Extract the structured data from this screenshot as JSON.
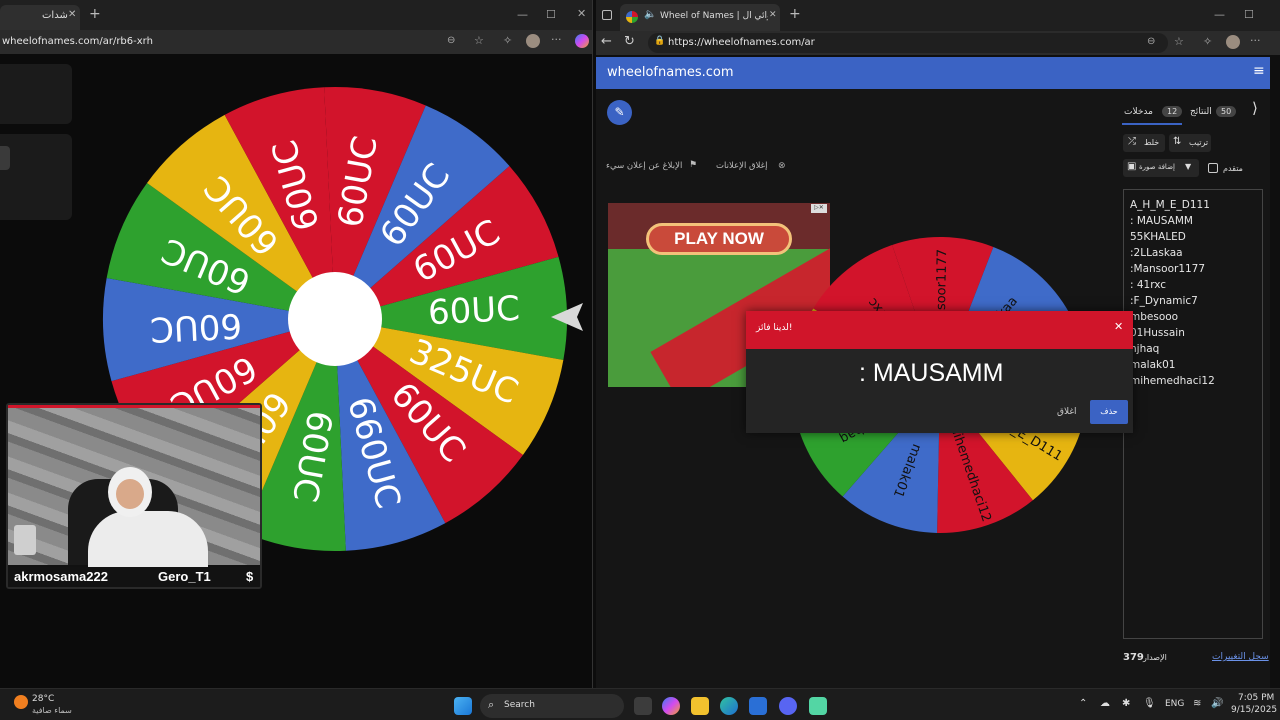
{
  "left_window": {
    "tab_title": "شدات",
    "url": "wheelofnames.com/ar/rb6-xrh",
    "wheel_slices": [
      {
        "label": "60UC",
        "color": "#d2142b"
      },
      {
        "label": "60UC",
        "color": "#2ea12e"
      },
      {
        "label": "325UC",
        "color": "#e6b511"
      },
      {
        "label": "60UC",
        "color": "#d2142b"
      },
      {
        "label": "660UC",
        "color": "#3f6bc9"
      },
      {
        "label": "60UC",
        "color": "#2ea12e"
      },
      {
        "label": "60UC",
        "color": "#e6b511"
      },
      {
        "label": "60UC",
        "color": "#d2142b"
      },
      {
        "label": "60UC",
        "color": "#3f6bc9"
      },
      {
        "label": "60UC",
        "color": "#2ea12e"
      },
      {
        "label": "60UC",
        "color": "#e6b511"
      },
      {
        "label": "60UC",
        "color": "#d2142b"
      },
      {
        "label": "60UC",
        "color": "#d2142b"
      },
      {
        "label": "60UC",
        "color": "#3f6bc9"
      }
    ]
  },
  "webcam": {
    "name_left": "akrmosama222",
    "name_right": "Gero_T1",
    "currency_symbol": "$"
  },
  "right_window": {
    "tab_title": "Wheel of Names | العشوائي ال",
    "url": "https://wheelofnames.com/ar",
    "site_name": "wheelofnames.com",
    "tabs": {
      "entries_label": "مدخلات",
      "entries_count": "12",
      "results_label": "النتائج",
      "results_count": "50"
    },
    "controls": {
      "shuffle": "خلط",
      "sort": "ترتيب",
      "add_image": "إضافة صورة",
      "advanced": "متقدم"
    },
    "ad_links": {
      "close_ads": "إغلاق الإعلانات",
      "report_ad": "الإبلاغ عن إعلان سيء"
    },
    "ad_banner_text": "PLAY NOW",
    "entries": [
      "A_H_M_E_D111",
      ": MAUSAMM",
      "55KHALED",
      ":2LLaskaa",
      ":Mansoor1177",
      ": 41rxc",
      ":F_Dynamic7",
      "mbesooo",
      "01Hussain",
      "hjhaq",
      "malak01",
      "mihemedhaci12"
    ],
    "version_label": "الإصدار",
    "version_number": "379",
    "changelog": "سجل التغييرات",
    "wheel_labels": [
      "Mansoor1177",
      "Laskaa",
      "MAUSAMM",
      "A_H_M_E_D111",
      "mihemedhaci12",
      "malak01",
      "zhjhaq",
      "01Hussain",
      "41rxc"
    ],
    "modal": {
      "title": "لدينا فائز!",
      "winner": ": MAUSAMM",
      "close_btn": "اغلاق",
      "remove_btn": "حذف"
    }
  },
  "taskbar": {
    "weather_temp": "28°C",
    "weather_desc": "سماء صافية",
    "search_placeholder": "Search",
    "language": "ENG",
    "time": "7:05 PM",
    "date": "9/15/2025"
  }
}
